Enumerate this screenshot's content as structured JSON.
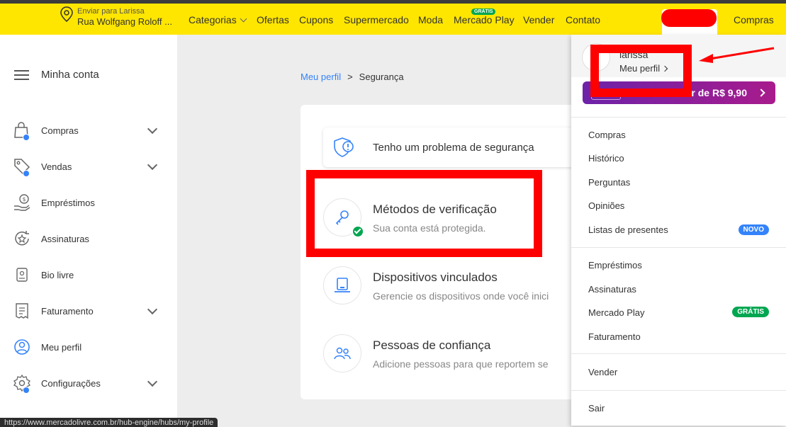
{
  "header": {
    "location_line1": "Enviar para Larissa",
    "location_line2": "Rua Wolfgang Roloff ...",
    "nav": {
      "categorias": "Categorias",
      "ofertas": "Ofertas",
      "cupons": "Cupons",
      "supermercado": "Supermercado",
      "moda": "Moda",
      "mercado_play": "Mercado Play",
      "mercado_play_badge": "GRÁTIS",
      "vender": "Vender",
      "contato": "Contato",
      "compras": "Compras"
    },
    "colors": {
      "background": "#ffe600",
      "accent": "#3483fa"
    }
  },
  "sidebar": {
    "title": "Minha conta",
    "items": [
      {
        "label": "Compras",
        "icon": "shopping-bag-icon",
        "expandable": true
      },
      {
        "label": "Vendas",
        "icon": "tag-icon",
        "expandable": true
      },
      {
        "label": "Empréstimos",
        "icon": "loan-icon",
        "expandable": false
      },
      {
        "label": "Assinaturas",
        "icon": "subscription-icon",
        "expandable": false
      },
      {
        "label": "Bio livre",
        "icon": "bio-icon",
        "expandable": false
      },
      {
        "label": "Faturamento",
        "icon": "invoice-icon",
        "expandable": true
      },
      {
        "label": "Meu perfil",
        "icon": "profile-icon",
        "expandable": false
      },
      {
        "label": "Configurações",
        "icon": "settings-icon",
        "expandable": true
      }
    ]
  },
  "breadcrumb": {
    "parent": "Meu perfil",
    "current": "Segurança"
  },
  "security": {
    "problem_label": "Tenho um problema de segurança",
    "options": [
      {
        "title": "Métodos de verificação",
        "subtitle": "Sua conta está protegida."
      },
      {
        "title": "Dispositivos vinculados",
        "subtitle": "Gerencie os dispositivos onde você inici"
      },
      {
        "title": "Pessoas de confiança",
        "subtitle": "Adicione pessoas para que reportem se"
      }
    ]
  },
  "dropdown": {
    "user_name": "larissa",
    "profile_link": "Meu perfil",
    "promo_text": "r de R$ 9,90",
    "group1": [
      "Compras",
      "Histórico",
      "Perguntas",
      "Opiniões",
      "Listas de presentes"
    ],
    "badge_novo": "NOVO",
    "group2": [
      "Empréstimos",
      "Assinaturas",
      "Mercado Play",
      "Faturamento"
    ],
    "badge_gratis": "GRÁTIS",
    "vender": "Vender",
    "sair": "Sair"
  },
  "status_bar": "https://www.mercadolivre.com.br/hub-engine/hubs/my-profile"
}
